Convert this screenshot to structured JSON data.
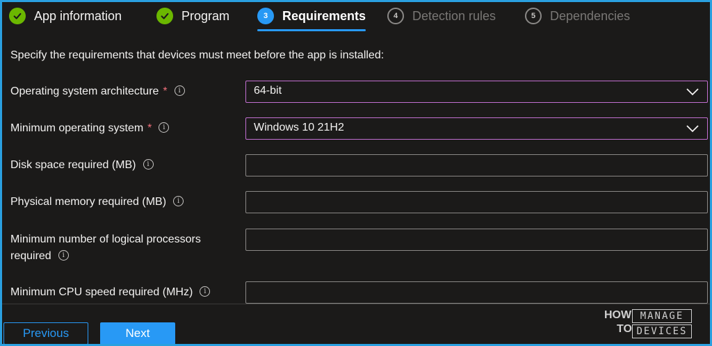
{
  "steps": [
    {
      "number": "1",
      "label": "App information",
      "state": "done"
    },
    {
      "number": "2",
      "label": "Program",
      "state": "done"
    },
    {
      "number": "3",
      "label": "Requirements",
      "state": "current"
    },
    {
      "number": "4",
      "label": "Detection rules",
      "state": "future"
    },
    {
      "number": "5",
      "label": "Dependencies",
      "state": "future"
    }
  ],
  "intro": "Specify the requirements that devices must meet before the app is installed:",
  "fields": {
    "architecture": {
      "label": "Operating system architecture",
      "required": "*",
      "value": "64-bit"
    },
    "min_os": {
      "label": "Minimum operating system",
      "required": "*",
      "value": "Windows 10 21H2"
    },
    "disk": {
      "label": "Disk space required (MB)",
      "value": ""
    },
    "memory": {
      "label": "Physical memory required (MB)",
      "value": ""
    },
    "processors": {
      "label_line1": "Minimum number of logical processors",
      "label_line2": "required",
      "value": ""
    },
    "cpu": {
      "label": "Minimum CPU speed required (MHz)",
      "value": ""
    }
  },
  "footer": {
    "previous": "Previous",
    "next": "Next"
  },
  "logo": {
    "word1": "HOW",
    "word2": "TO",
    "box1": "MANAGE",
    "box2": "DEVICES"
  },
  "colors": {
    "accent": "#2899f5",
    "success": "#6bb700",
    "required": "#f1707b",
    "select_border": "#c26fd1",
    "background": "#1b1a19"
  },
  "icons": {
    "done": "checkmark-icon",
    "info": "info-icon",
    "dropdown": "chevron-down-icon"
  }
}
